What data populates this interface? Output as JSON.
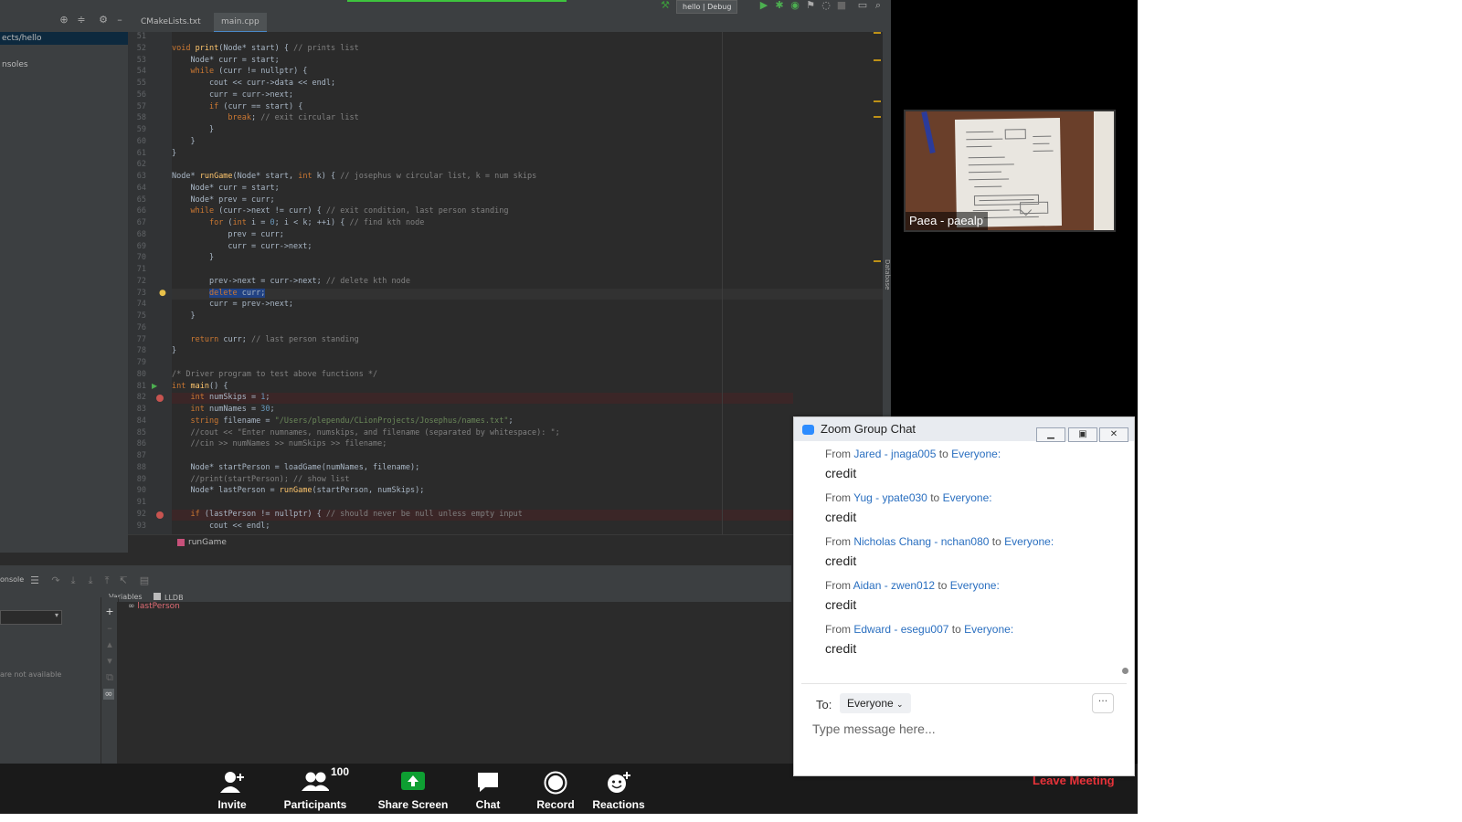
{
  "ide": {
    "tabs": [
      "CMakeLists.txt",
      "main.cpp"
    ],
    "run_config": "hello | Debug",
    "project_rows": [
      "ects/hello",
      "nsoles"
    ],
    "database_label": "Database",
    "breadcrumb": "runGame",
    "debug": {
      "console_label": "onsole",
      "tab_variables": "Variables",
      "tab_lldb": "LLDB",
      "variable": "lastPerson",
      "frames_unavailable": "are not available"
    },
    "code_lines": [
      {
        "n": "51",
        "t": ""
      },
      {
        "n": "52",
        "t": "void print(Node* start) { // prints list"
      },
      {
        "n": "53",
        "t": "    Node* curr = start;"
      },
      {
        "n": "54",
        "t": "    while (curr != nullptr) {"
      },
      {
        "n": "55",
        "t": "        cout << curr->data << endl;"
      },
      {
        "n": "56",
        "t": "        curr = curr->next;"
      },
      {
        "n": "57",
        "t": "        if (curr == start) {"
      },
      {
        "n": "58",
        "t": "            break; // exit circular list"
      },
      {
        "n": "59",
        "t": "        }"
      },
      {
        "n": "60",
        "t": "    }"
      },
      {
        "n": "61",
        "t": "}"
      },
      {
        "n": "62",
        "t": ""
      },
      {
        "n": "63",
        "t": "Node* runGame(Node* start, int k) { // josephus w circular list, k = num skips"
      },
      {
        "n": "64",
        "t": "    Node* curr = start;"
      },
      {
        "n": "65",
        "t": "    Node* prev = curr;"
      },
      {
        "n": "66",
        "t": "    while (curr->next != curr) { // exit condition, last person standing"
      },
      {
        "n": "67",
        "t": "        for (int i = 0; i < k; ++i) { // find kth node"
      },
      {
        "n": "68",
        "t": "            prev = curr;"
      },
      {
        "n": "69",
        "t": "            curr = curr->next;"
      },
      {
        "n": "70",
        "t": "        }"
      },
      {
        "n": "71",
        "t": ""
      },
      {
        "n": "72",
        "t": "        prev->next = curr->next; // delete kth node"
      },
      {
        "n": "73",
        "t": "        delete curr;"
      },
      {
        "n": "74",
        "t": "        curr = prev->next;"
      },
      {
        "n": "75",
        "t": "    }"
      },
      {
        "n": "76",
        "t": ""
      },
      {
        "n": "77",
        "t": "    return curr; // last person standing"
      },
      {
        "n": "78",
        "t": "}"
      },
      {
        "n": "79",
        "t": ""
      },
      {
        "n": "80",
        "t": "/* Driver program to test above functions */"
      },
      {
        "n": "81",
        "t": "int main() {"
      },
      {
        "n": "82",
        "t": "    int numSkips = 1;"
      },
      {
        "n": "83",
        "t": "    int numNames = 30;"
      },
      {
        "n": "84",
        "t": "    string filename = \"/Users/plependu/CLionProjects/Josephus/names.txt\";"
      },
      {
        "n": "85",
        "t": "    //cout << \"Enter numnames, numskips, and filename (separated by whitespace): \";"
      },
      {
        "n": "86",
        "t": "    //cin >> numNames >> numSkips >> filename;"
      },
      {
        "n": "87",
        "t": ""
      },
      {
        "n": "88",
        "t": "    Node* startPerson = loadGame(numNames, filename);"
      },
      {
        "n": "89",
        "t": "    //print(startPerson); // show list"
      },
      {
        "n": "90",
        "t": "    Node* lastPerson = runGame(startPerson, numSkips);"
      },
      {
        "n": "91",
        "t": ""
      },
      {
        "n": "92",
        "t": "    if (lastPerson != nullptr) { // should never be null unless empty input"
      },
      {
        "n": "93",
        "t": "        cout << endl;"
      }
    ]
  },
  "video": {
    "participant_label": "Paea - paealp"
  },
  "chat": {
    "title": "Zoom Group Chat",
    "messages": [
      {
        "from_word": "From",
        "sender": "Jared - jnaga005",
        "to_word": "to",
        "recipient": "Everyone:",
        "body": "credit"
      },
      {
        "from_word": "From",
        "sender": "Yug - ypate030",
        "to_word": "to",
        "recipient": "Everyone:",
        "body": "credit"
      },
      {
        "from_word": "From",
        "sender": "Nicholas Chang - nchan080",
        "to_word": "to",
        "recipient": "Everyone:",
        "body": "credit"
      },
      {
        "from_word": "From",
        "sender": "Aidan - zwen012",
        "to_word": "to",
        "recipient": "Everyone:",
        "body": "credit"
      },
      {
        "from_word": "From",
        "sender": "Edward - esegu007",
        "to_word": "to",
        "recipient": "Everyone:",
        "body": "credit"
      }
    ],
    "to_label": "To:",
    "to_value": "Everyone",
    "more_label": "···",
    "input_placeholder": "Type message here..."
  },
  "toolbar": {
    "invite": "Invite",
    "participants": "Participants",
    "participant_count": "100",
    "share_screen": "Share Screen",
    "chat": "Chat",
    "record": "Record",
    "reactions": "Reactions",
    "leave": "Leave Meeting"
  },
  "colors": {
    "accent": "#2d8cff",
    "leave": "#e8333a",
    "share": "#0e9f32",
    "sender_link": "#2a6fc0"
  }
}
